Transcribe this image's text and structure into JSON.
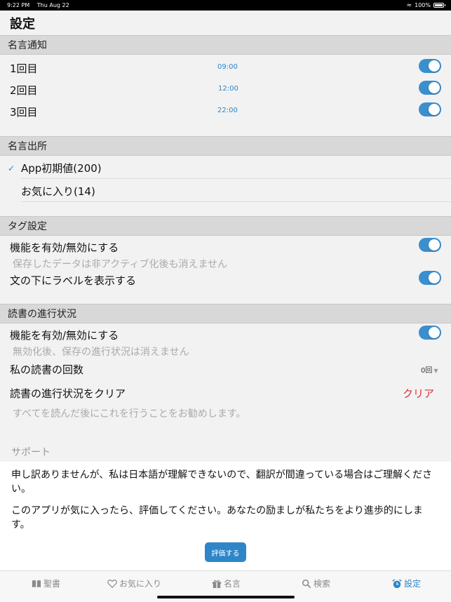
{
  "status_bar": {
    "time": "9:22 PM",
    "date": "Thu Aug 22",
    "battery": "100%"
  },
  "page_title": "設定",
  "quote_notification": {
    "header": "名言通知",
    "rows": [
      {
        "label": "1回目",
        "time": "09:00",
        "enabled": true
      },
      {
        "label": "2回目",
        "time": "12:00",
        "enabled": true
      },
      {
        "label": "3回目",
        "time": "22:00",
        "enabled": true
      }
    ]
  },
  "quote_source": {
    "header": "名言出所",
    "options": [
      {
        "label": "App初期値(200)",
        "selected": true
      },
      {
        "label": "お気に入り(14)",
        "selected": false
      }
    ]
  },
  "tag_settings": {
    "header": "タグ設定",
    "enable_label": "機能を有効/無効にする",
    "enable_note": "保存したデータは非アクティブ化後も消えません",
    "show_label_label": "文の下にラベルを表示する"
  },
  "reading_progress": {
    "header": "読書の進行状況",
    "enable_label": "機能を有効/無効にする",
    "enable_note": "無効化後、保存の進行状況は消えません",
    "count_label": "私の読書の回数",
    "count_value": "0回",
    "clear_label": "読書の進行状況をクリア",
    "clear_button": "クリア",
    "clear_note": "すべてを読んだ後にこれを行うことをお勧めします。"
  },
  "support": {
    "label": "サポート",
    "text1": "申し訳ありませんが、私は日本語が理解できないので、翻訳が間違っている場合はご理解ください。",
    "text2": "このアプリが気に入ったら、評価してください。あなたの励ましが私たちをより進歩的にします。",
    "rate_button": "評価する"
  },
  "tabs": [
    {
      "label": "聖書",
      "icon": "book-icon"
    },
    {
      "label": "お気に入り",
      "icon": "heart-icon"
    },
    {
      "label": "名言",
      "icon": "gift-icon"
    },
    {
      "label": "検索",
      "icon": "search-icon"
    },
    {
      "label": "設定",
      "icon": "alarm-icon",
      "active": true
    }
  ],
  "colors": {
    "accent": "#2e86c9",
    "danger": "#e0302f",
    "toggle_on": "#3a8fce"
  }
}
